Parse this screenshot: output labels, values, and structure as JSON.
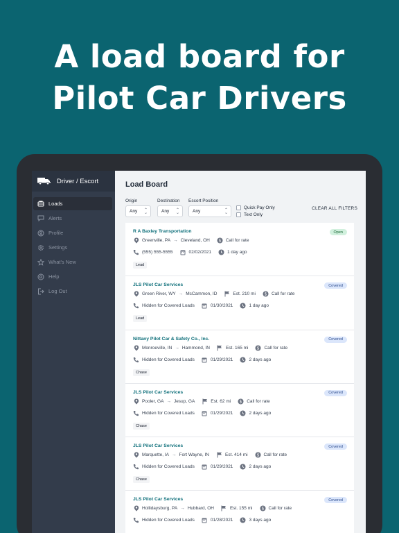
{
  "headline": {
    "line1": "A load board for",
    "line2": "Pilot Car Drivers"
  },
  "brand": {
    "title": "Driver / Escort"
  },
  "nav": {
    "items": [
      {
        "label": "Loads",
        "icon": "truck-icon",
        "active": true
      },
      {
        "label": "Alerts",
        "icon": "chat-icon"
      },
      {
        "label": "Profile",
        "icon": "user-circle-icon"
      },
      {
        "label": "Settings",
        "icon": "gear-icon"
      },
      {
        "label": "What's New",
        "icon": "star-icon"
      },
      {
        "label": "Help",
        "icon": "lifebuoy-icon"
      },
      {
        "label": "Log Out",
        "icon": "logout-icon"
      }
    ]
  },
  "page": {
    "title": "Load Board"
  },
  "filters": {
    "origin": {
      "label": "Origin",
      "value": "Any"
    },
    "destination": {
      "label": "Destination",
      "value": "Any"
    },
    "escort": {
      "label": "Escort Position",
      "value": "Any"
    },
    "quick_pay": "Quick Pay Only",
    "text_only": "Text Only",
    "clear": "CLEAR ALL FILTERS"
  },
  "colors": {
    "background": "#0b6470",
    "accent": "#0e6f7a",
    "open_badge": "#d1f0dd",
    "covered_badge": "#dbe6fb"
  },
  "loads": [
    {
      "company": "R A Baxley Transportation",
      "status": "Open",
      "origin": "Greenville, PA",
      "destination": "Cleveland, OH",
      "miles": "",
      "rate": "Call for rate",
      "phone": "(555) 555-5555",
      "date": "02/02/2021",
      "age": "1 day ago",
      "position": "Lead"
    },
    {
      "company": "JLS Pilot Car Services",
      "status": "Covered",
      "origin": "Green River, WY",
      "destination": "McCammon, ID",
      "miles": "Est. 210 mi",
      "rate": "Call for rate",
      "phone": "Hidden for Covered Loads",
      "date": "01/30/2021",
      "age": "1 day ago",
      "position": "Lead"
    },
    {
      "company": "Nittany Pilot Car & Safety Co., Inc.",
      "status": "Covered",
      "origin": "Monroeville, IN",
      "destination": "Hammond, IN",
      "miles": "Est. 165 mi",
      "rate": "Call for rate",
      "phone": "Hidden for Covered Loads",
      "date": "01/29/2021",
      "age": "2 days ago",
      "position": "Chase"
    },
    {
      "company": "JLS Pilot Car Services",
      "status": "Covered",
      "origin": "Pooler, GA",
      "destination": "Jesup, GA",
      "miles": "Est. 62 mi",
      "rate": "Call for rate",
      "phone": "Hidden for Covered Loads",
      "date": "01/29/2021",
      "age": "2 days ago",
      "position": "Chase"
    },
    {
      "company": "JLS Pilot Car Services",
      "status": "Covered",
      "origin": "Marquette, IA",
      "destination": "Fort Wayne, IN",
      "miles": "Est. 414 mi",
      "rate": "Call for rate",
      "phone": "Hidden for Covered Loads",
      "date": "01/29/2021",
      "age": "2 days ago",
      "position": "Chase"
    },
    {
      "company": "JLS Pilot Car Services",
      "status": "Covered",
      "origin": "Hollidaysburg, PA",
      "destination": "Hubbard, OH",
      "miles": "Est. 155 mi",
      "rate": "Call for rate",
      "phone": "Hidden for Covered Loads",
      "date": "01/28/2021",
      "age": "3 days ago",
      "position": ""
    }
  ]
}
